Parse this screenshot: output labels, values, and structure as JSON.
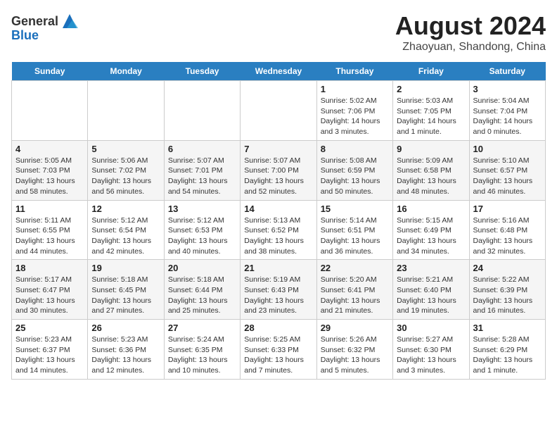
{
  "logo": {
    "text_general": "General",
    "text_blue": "Blue"
  },
  "title": "August 2024",
  "subtitle": "Zhaoyuan, Shandong, China",
  "days_of_week": [
    "Sunday",
    "Monday",
    "Tuesday",
    "Wednesday",
    "Thursday",
    "Friday",
    "Saturday"
  ],
  "weeks": [
    [
      {
        "date": "",
        "text": ""
      },
      {
        "date": "",
        "text": ""
      },
      {
        "date": "",
        "text": ""
      },
      {
        "date": "",
        "text": ""
      },
      {
        "date": "1",
        "text": "Sunrise: 5:02 AM\nSunset: 7:06 PM\nDaylight: 14 hours\nand 3 minutes."
      },
      {
        "date": "2",
        "text": "Sunrise: 5:03 AM\nSunset: 7:05 PM\nDaylight: 14 hours\nand 1 minute."
      },
      {
        "date": "3",
        "text": "Sunrise: 5:04 AM\nSunset: 7:04 PM\nDaylight: 14 hours\nand 0 minutes."
      }
    ],
    [
      {
        "date": "4",
        "text": "Sunrise: 5:05 AM\nSunset: 7:03 PM\nDaylight: 13 hours\nand 58 minutes."
      },
      {
        "date": "5",
        "text": "Sunrise: 5:06 AM\nSunset: 7:02 PM\nDaylight: 13 hours\nand 56 minutes."
      },
      {
        "date": "6",
        "text": "Sunrise: 5:07 AM\nSunset: 7:01 PM\nDaylight: 13 hours\nand 54 minutes."
      },
      {
        "date": "7",
        "text": "Sunrise: 5:07 AM\nSunset: 7:00 PM\nDaylight: 13 hours\nand 52 minutes."
      },
      {
        "date": "8",
        "text": "Sunrise: 5:08 AM\nSunset: 6:59 PM\nDaylight: 13 hours\nand 50 minutes."
      },
      {
        "date": "9",
        "text": "Sunrise: 5:09 AM\nSunset: 6:58 PM\nDaylight: 13 hours\nand 48 minutes."
      },
      {
        "date": "10",
        "text": "Sunrise: 5:10 AM\nSunset: 6:57 PM\nDaylight: 13 hours\nand 46 minutes."
      }
    ],
    [
      {
        "date": "11",
        "text": "Sunrise: 5:11 AM\nSunset: 6:55 PM\nDaylight: 13 hours\nand 44 minutes."
      },
      {
        "date": "12",
        "text": "Sunrise: 5:12 AM\nSunset: 6:54 PM\nDaylight: 13 hours\nand 42 minutes."
      },
      {
        "date": "13",
        "text": "Sunrise: 5:12 AM\nSunset: 6:53 PM\nDaylight: 13 hours\nand 40 minutes."
      },
      {
        "date": "14",
        "text": "Sunrise: 5:13 AM\nSunset: 6:52 PM\nDaylight: 13 hours\nand 38 minutes."
      },
      {
        "date": "15",
        "text": "Sunrise: 5:14 AM\nSunset: 6:51 PM\nDaylight: 13 hours\nand 36 minutes."
      },
      {
        "date": "16",
        "text": "Sunrise: 5:15 AM\nSunset: 6:49 PM\nDaylight: 13 hours\nand 34 minutes."
      },
      {
        "date": "17",
        "text": "Sunrise: 5:16 AM\nSunset: 6:48 PM\nDaylight: 13 hours\nand 32 minutes."
      }
    ],
    [
      {
        "date": "18",
        "text": "Sunrise: 5:17 AM\nSunset: 6:47 PM\nDaylight: 13 hours\nand 30 minutes."
      },
      {
        "date": "19",
        "text": "Sunrise: 5:18 AM\nSunset: 6:45 PM\nDaylight: 13 hours\nand 27 minutes."
      },
      {
        "date": "20",
        "text": "Sunrise: 5:18 AM\nSunset: 6:44 PM\nDaylight: 13 hours\nand 25 minutes."
      },
      {
        "date": "21",
        "text": "Sunrise: 5:19 AM\nSunset: 6:43 PM\nDaylight: 13 hours\nand 23 minutes."
      },
      {
        "date": "22",
        "text": "Sunrise: 5:20 AM\nSunset: 6:41 PM\nDaylight: 13 hours\nand 21 minutes."
      },
      {
        "date": "23",
        "text": "Sunrise: 5:21 AM\nSunset: 6:40 PM\nDaylight: 13 hours\nand 19 minutes."
      },
      {
        "date": "24",
        "text": "Sunrise: 5:22 AM\nSunset: 6:39 PM\nDaylight: 13 hours\nand 16 minutes."
      }
    ],
    [
      {
        "date": "25",
        "text": "Sunrise: 5:23 AM\nSunset: 6:37 PM\nDaylight: 13 hours\nand 14 minutes."
      },
      {
        "date": "26",
        "text": "Sunrise: 5:23 AM\nSunset: 6:36 PM\nDaylight: 13 hours\nand 12 minutes."
      },
      {
        "date": "27",
        "text": "Sunrise: 5:24 AM\nSunset: 6:35 PM\nDaylight: 13 hours\nand 10 minutes."
      },
      {
        "date": "28",
        "text": "Sunrise: 5:25 AM\nSunset: 6:33 PM\nDaylight: 13 hours\nand 7 minutes."
      },
      {
        "date": "29",
        "text": "Sunrise: 5:26 AM\nSunset: 6:32 PM\nDaylight: 13 hours\nand 5 minutes."
      },
      {
        "date": "30",
        "text": "Sunrise: 5:27 AM\nSunset: 6:30 PM\nDaylight: 13 hours\nand 3 minutes."
      },
      {
        "date": "31",
        "text": "Sunrise: 5:28 AM\nSunset: 6:29 PM\nDaylight: 13 hours\nand 1 minute."
      }
    ]
  ]
}
